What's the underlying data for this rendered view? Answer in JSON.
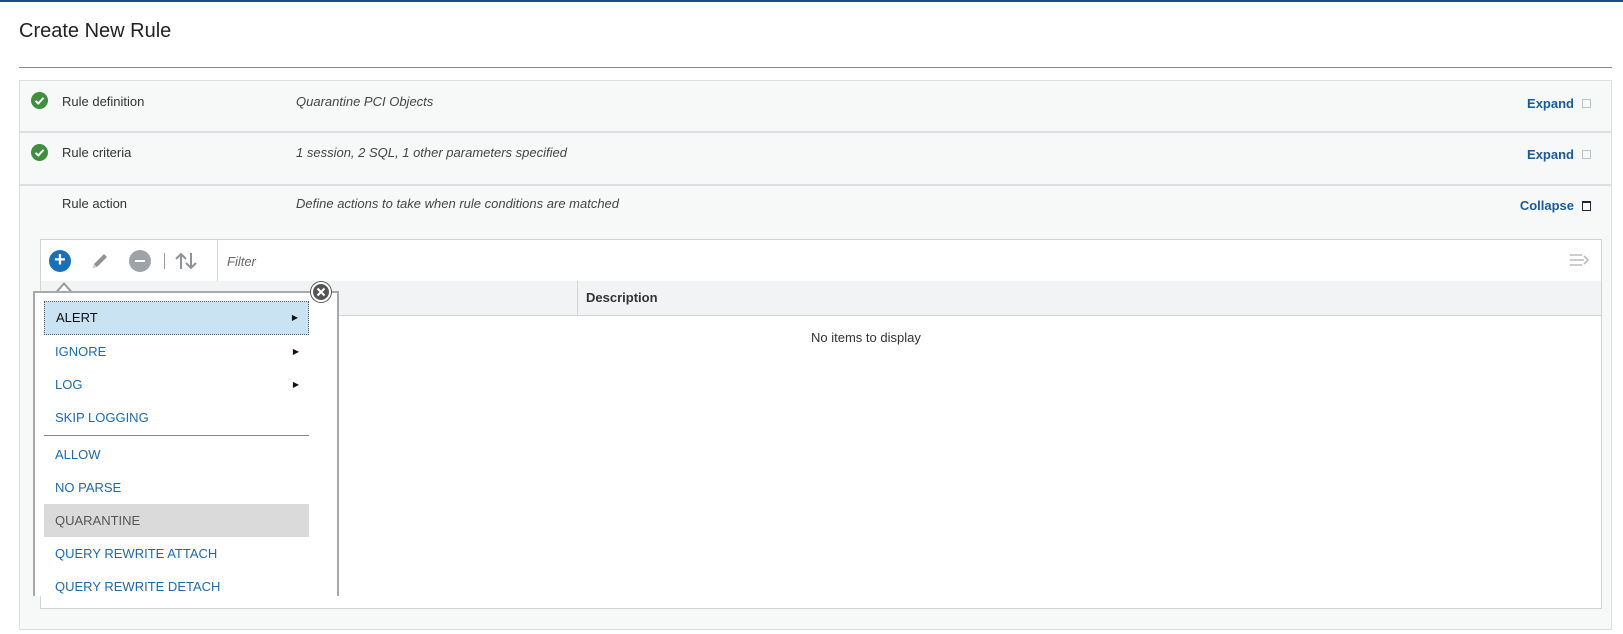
{
  "page": {
    "title": "Create New Rule"
  },
  "sections": [
    {
      "label": "Rule definition",
      "summary": "Quarantine PCI Objects",
      "toggle": "Expand",
      "status": "complete"
    },
    {
      "label": "Rule criteria",
      "summary": "1 session, 2 SQL, 1 other parameters specified",
      "toggle": "Expand",
      "status": "complete"
    },
    {
      "label": "Rule action",
      "summary": "Define actions to take when rule conditions are matched",
      "toggle": "Collapse",
      "status": "none"
    }
  ],
  "toolbar": {
    "add_icon": "plus-circle-icon",
    "edit_icon": "pencil-icon",
    "remove_icon": "minus-circle-icon",
    "sort_icon": "sort-arrows-icon",
    "filter_placeholder": "Filter",
    "settings_icon": "column-settings-icon"
  },
  "grid": {
    "columns": [
      "",
      "Description"
    ],
    "empty_message": "No items to display"
  },
  "action_menu": {
    "items": [
      {
        "label": "ALERT",
        "submenu": true,
        "state": "active"
      },
      {
        "label": "IGNORE",
        "submenu": true,
        "state": "normal"
      },
      {
        "label": "LOG",
        "submenu": true,
        "state": "normal"
      },
      {
        "label": "SKIP LOGGING",
        "submenu": false,
        "state": "normal"
      },
      {
        "label": "ALLOW",
        "submenu": false,
        "state": "normal"
      },
      {
        "label": "NO PARSE",
        "submenu": false,
        "state": "normal"
      },
      {
        "label": "QUARANTINE",
        "submenu": false,
        "state": "disabled"
      },
      {
        "label": "QUERY REWRITE ATTACH",
        "submenu": false,
        "state": "normal"
      },
      {
        "label": "QUERY REWRITE DETACH",
        "submenu": false,
        "state": "normal"
      }
    ]
  },
  "colors": {
    "accent": "#1a5a96",
    "success": "#3f8f3f",
    "menu_active_bg": "#c9e3f2",
    "menu_disabled_bg": "#dadada"
  }
}
